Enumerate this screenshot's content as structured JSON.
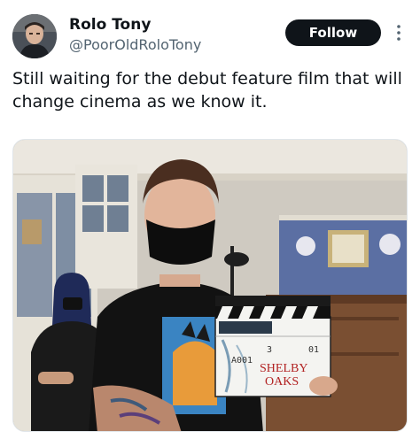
{
  "user": {
    "display_name": "Rolo Tony",
    "handle": "@PoorOldRoloTony",
    "avatar_icon": "profile-avatar"
  },
  "actions": {
    "follow_label": "Follow",
    "more_icon": "vertical-ellipsis-icon"
  },
  "tweet": {
    "text": "Still waiting for the debut feature film that will change cinema as we know it."
  },
  "media": {
    "clapperboard": {
      "title_line1": "SHELBY",
      "title_line2": "OAKS",
      "scene": "3",
      "take": "01",
      "roll": "A001"
    }
  },
  "colors": {
    "follow_bg": "#0f1419",
    "handle": "#536471",
    "text": "#0f1419"
  }
}
